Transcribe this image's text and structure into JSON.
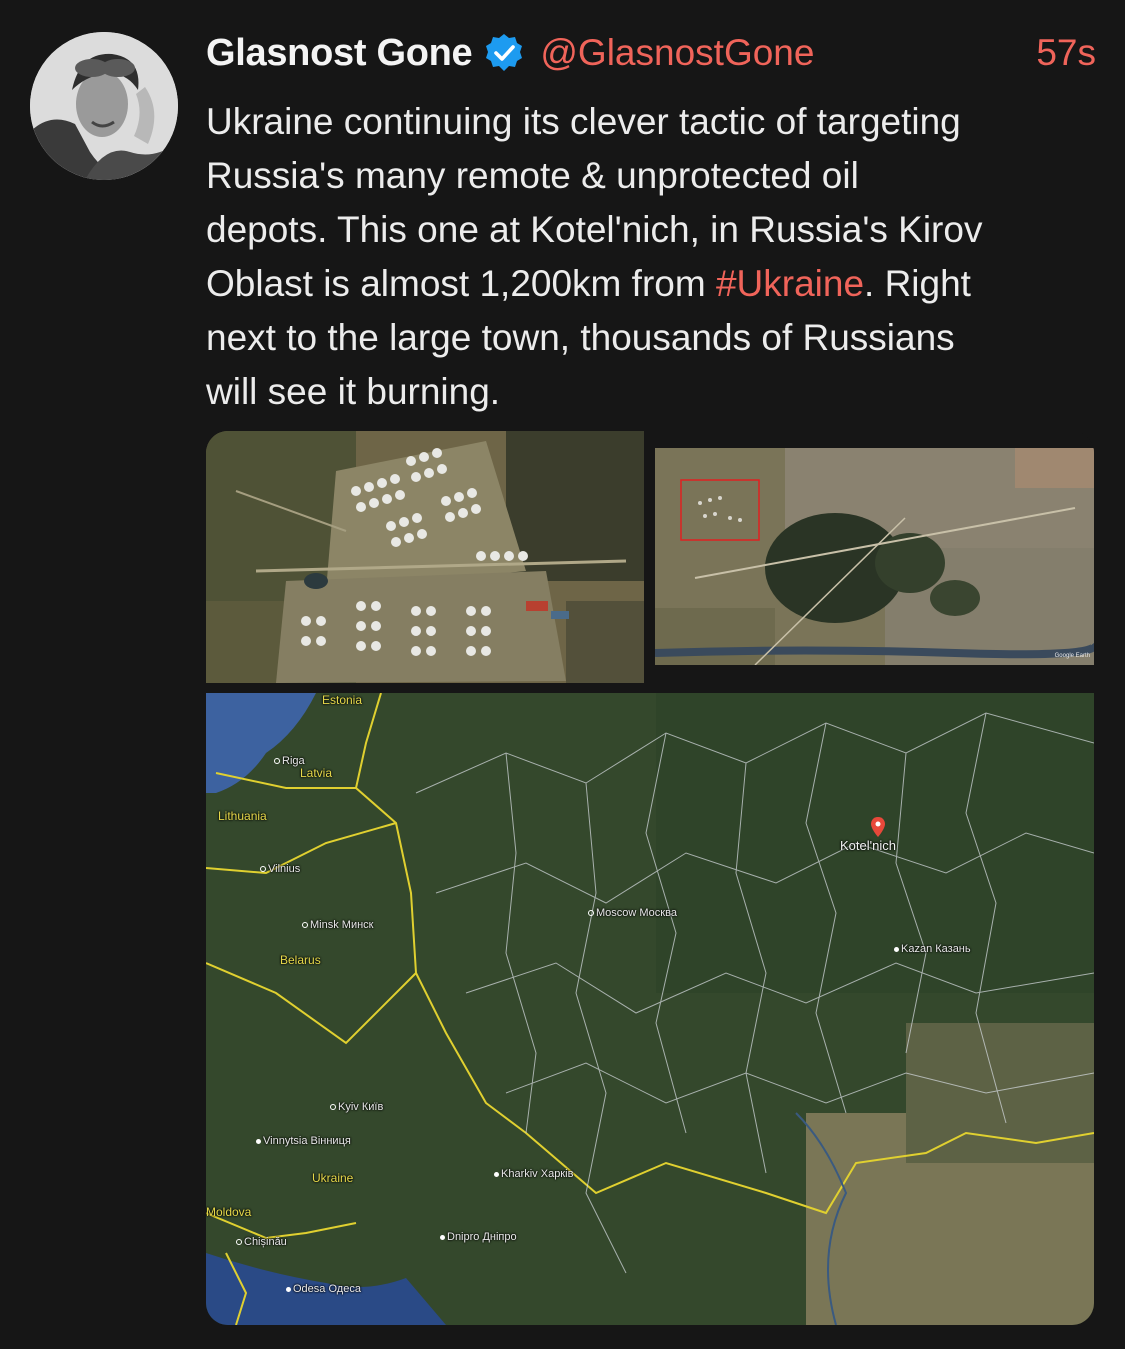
{
  "author": {
    "name": "Glasnost Gone",
    "handle": "@GlasnostGone",
    "timestamp": "57s",
    "verified": true,
    "avatar_icon": "pilot-portrait-avatar"
  },
  "tweet": {
    "text_before": "Ukraine continuing its clever tactic of targeting\nRussia's many remote & unprotected oil\ndepots. This one at Kotel'nich, in Russia's Kirov\nOblast is almost 1,200km from ",
    "hashtag": "#Ukraine",
    "text_after": ". Right\nnext to the large town, thousands of Russians\nwill see it burning."
  },
  "media": {
    "town_watermark": "Google Earth",
    "map_labels": {
      "estonia": "Estonia",
      "riga": "Riga",
      "latvia": "Latvia",
      "lithuania": "Lithuania",
      "vilnius": "Vilnius",
      "minsk": "Minsk Минск",
      "belarus": "Belarus",
      "moscow": "Moscow Москва",
      "kotelnich": "Kotel'nich",
      "kazan": "Kazan Казань",
      "kyiv": "Kyiv Київ",
      "vinnytsia": "Vinnytsia Вінниця",
      "ukraine": "Ukraine",
      "kharkiv": "Kharkiv Харків",
      "moldova": "Moldova",
      "chisinau": "Chișinău",
      "dnipro": "Dnipro Дніпро",
      "odesa": "Odesa Одеса"
    }
  },
  "colors": {
    "background": "#161616",
    "accent": "#f0645a",
    "verified_badge": "#1d9bf0",
    "text": "#ececec"
  }
}
